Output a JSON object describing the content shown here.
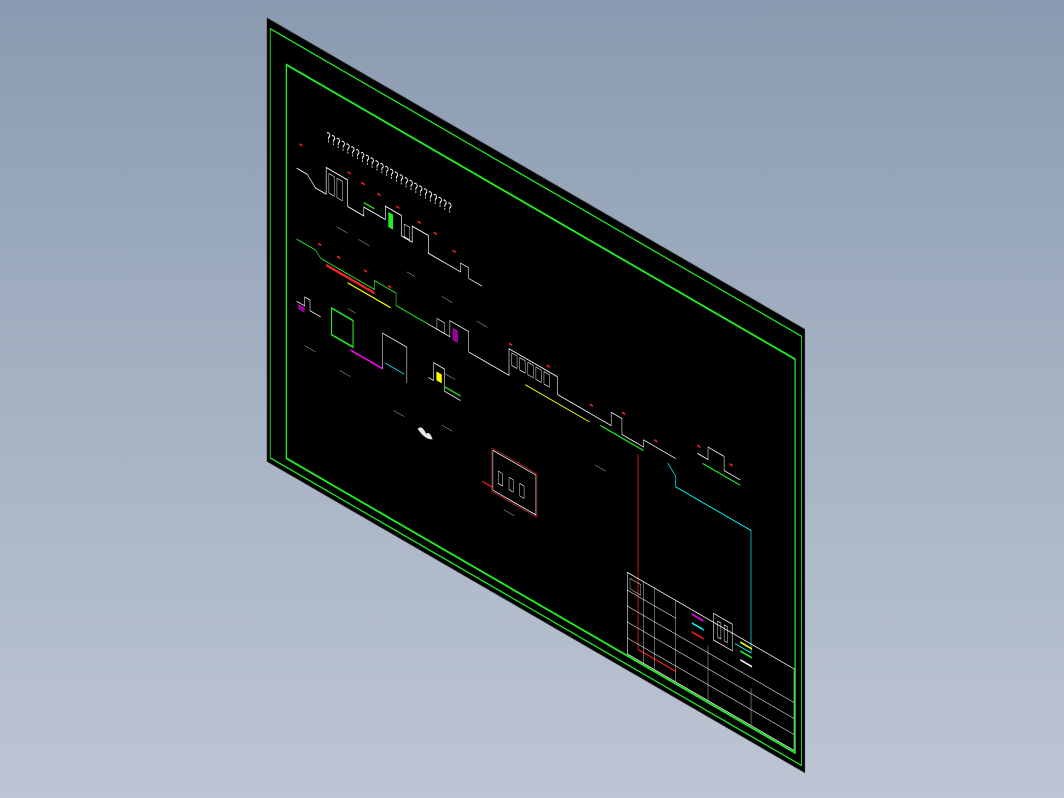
{
  "drawing": {
    "title": "??????????????????????????",
    "section_labels": [
      "",
      "",
      "",
      "",
      "",
      "",
      "",
      "",
      "",
      "",
      "",
      "",
      "",
      ""
    ],
    "legend_items": [
      {
        "color": "#ff00ff",
        "label": ""
      },
      {
        "color": "#00ffff",
        "label": ""
      },
      {
        "color": "#ff0000",
        "label": ""
      },
      {
        "color": "#ffff00",
        "label": ""
      },
      {
        "color": "#00ff00",
        "label": ""
      },
      {
        "color": "#ffffff",
        "label": ""
      }
    ]
  },
  "colors": {
    "sheet_background": "#000000",
    "frame": "#00ff00",
    "outline": "#ffffff",
    "dimension": "#ff0000",
    "pipe_yellow": "#ffff00",
    "pipe_cyan": "#00ffff",
    "pipe_magenta": "#ff00ff",
    "viewport_background": "#98a6b9"
  },
  "icons": [
    "cad-drawing-sheet-icon"
  ]
}
